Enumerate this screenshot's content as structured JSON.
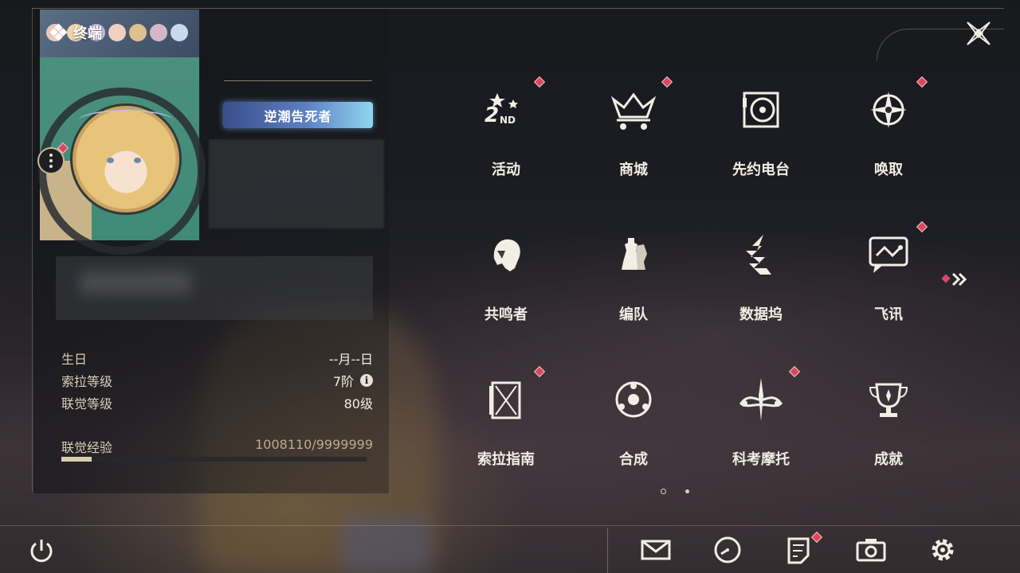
{
  "header": {
    "title": "终端"
  },
  "profile": {
    "title_badge": "逆潮告死者",
    "stats": [
      {
        "key": "生日",
        "value": "--月--日"
      },
      {
        "key": "索拉等级",
        "value": "7阶"
      },
      {
        "key": "联觉等级",
        "value": "80级"
      }
    ],
    "exp": {
      "label": "联觉经验",
      "value": "1008110/9999999",
      "progress": 0.1
    }
  },
  "menu": [
    {
      "label": "活动",
      "icon": "2nd-anniversary-icon",
      "badge": true
    },
    {
      "label": "商城",
      "icon": "crown-cart-icon",
      "badge": true
    },
    {
      "label": "先约电台",
      "icon": "vinyl-radio-icon",
      "badge": false
    },
    {
      "label": "唤取",
      "icon": "compass-star-icon",
      "badge": true
    },
    {
      "label": "共鸣者",
      "icon": "character-head-icon",
      "badge": false
    },
    {
      "label": "编队",
      "icon": "chess-pieces-icon",
      "badge": false
    },
    {
      "label": "数据坞",
      "icon": "data-dock-icon",
      "badge": false
    },
    {
      "label": "飞讯",
      "icon": "chat-bubble-icon",
      "badge": true
    },
    {
      "label": "索拉指南",
      "icon": "guide-book-icon",
      "badge": true
    },
    {
      "label": "合成",
      "icon": "synthesis-orb-icon",
      "badge": false
    },
    {
      "label": "科考摩托",
      "icon": "motorcycle-icon",
      "badge": true
    },
    {
      "label": "成就",
      "icon": "trophy-icon",
      "badge": false
    }
  ],
  "pagination": {
    "current": 1,
    "total": 2
  },
  "bottom_bar": [
    {
      "name": "mail-icon",
      "badge": false
    },
    {
      "name": "clock-icon",
      "badge": false
    },
    {
      "name": "notice-icon",
      "badge": true
    },
    {
      "name": "camera-icon",
      "badge": false
    },
    {
      "name": "settings-gear-icon",
      "badge": false
    }
  ],
  "colors": {
    "badge": "#d9485e",
    "accent": "#d9cdb0",
    "avatar_bg": "#4b8f7e"
  }
}
